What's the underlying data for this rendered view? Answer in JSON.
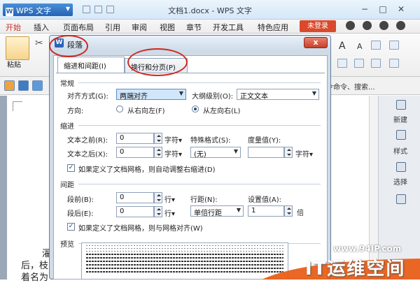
{
  "app": {
    "name": "WPS 文字",
    "doc_title": "文档1.docx - WPS 文字"
  },
  "window_controls": [
    "−",
    "□",
    "✕"
  ],
  "menu": {
    "items": [
      "开始",
      "插入",
      "页面布局",
      "引用",
      "审阅",
      "视图",
      "章节",
      "开发工具",
      "特色应用"
    ],
    "login": "未登录"
  },
  "toolbar": {
    "paste": "粘贴",
    "fontsize_grow": "A",
    "fontsize_shrink": "A",
    "search_hint": "令命令、搜索..."
  },
  "right_pane": {
    "new": "新建",
    "style": "样式",
    "select": "选择"
  },
  "document": {
    "line1": "濯",
    "line2": "后，枝",
    "line3": "着名为"
  },
  "dialog": {
    "title": "段落",
    "close": "x",
    "tabs": [
      "缩进和间距(I)",
      "换行和分页(P)"
    ],
    "general": {
      "section": "常规",
      "alignment_label": "对齐方式(G):",
      "alignment_value": "两端对齐",
      "outline_label": "大纲级别(O):",
      "outline_value": "正文文本",
      "direction_label": "方向:",
      "rtl_label": "从右向左(F)",
      "ltr_label": "从左向右(L)",
      "direction_selected": "ltr"
    },
    "indent": {
      "section": "缩进",
      "before_label": "文本之前(R):",
      "before_value": "0",
      "before_unit": "字符",
      "after_label": "文本之后(X):",
      "after_value": "0",
      "after_unit": "字符",
      "special_label": "特殊格式(S):",
      "special_value": "(无)",
      "measure_label": "度量值(Y):",
      "measure_value": "",
      "measure_unit": "字符",
      "auto_adjust": "如果定义了文档网格，则自动调整右缩进(D)",
      "auto_adjust_checked": true
    },
    "spacing": {
      "section": "间距",
      "before_label": "段前(B):",
      "before_value": "0",
      "before_unit": "行",
      "after_label": "段后(E):",
      "after_value": "0",
      "after_unit": "行",
      "line_label": "行距(N):",
      "line_value": "单倍行距",
      "setting_label": "设置值(A):",
      "setting_value": "1",
      "setting_unit": "倍",
      "snap_grid": "如果定义了文档网格，则与网格对齐(W)",
      "snap_grid_checked": true
    },
    "preview": {
      "section": "预览"
    }
  },
  "watermark": {
    "url": "www.94IP.com",
    "text": "IT运维空间"
  },
  "colors": {
    "accent_red": "#d0281f",
    "login_red": "#d9492c",
    "title_blue": "#2563b4"
  }
}
